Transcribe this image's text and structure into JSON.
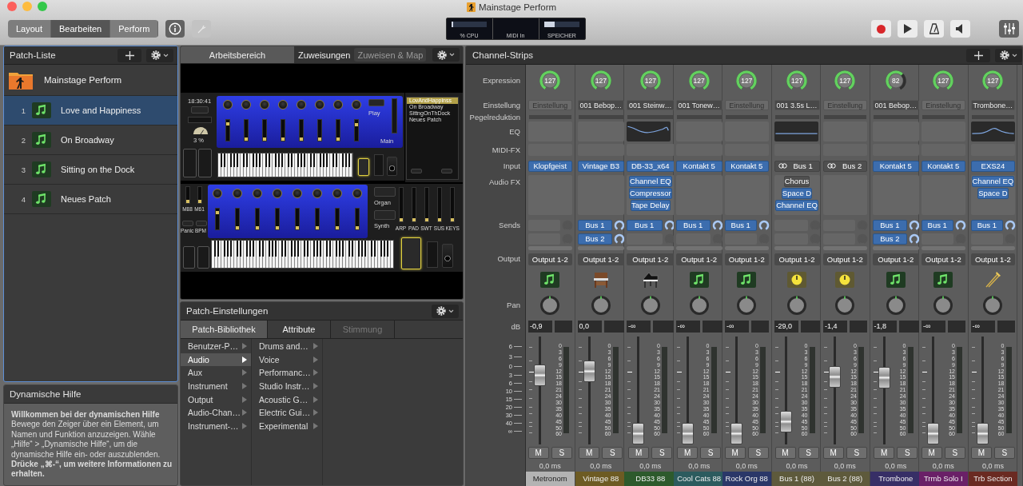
{
  "window": {
    "title": "Mainstage Perform"
  },
  "toolbar": {
    "modes": [
      {
        "label": "Layout",
        "selected": false
      },
      {
        "label": "Bearbeiten",
        "selected": true
      },
      {
        "label": "Perform",
        "selected": false
      }
    ],
    "meters": [
      {
        "label": "% CPU",
        "level": 0.05
      },
      {
        "label": "MIDI In"
      },
      {
        "label": "SPEICHER",
        "level": 0.3
      }
    ]
  },
  "patch_list": {
    "title": "Patch-Liste",
    "concert": "Mainstage Perform",
    "patches": [
      {
        "number": "1",
        "name": "Love and Happiness",
        "selected": true
      },
      {
        "number": "2",
        "name": "On Broadway",
        "selected": false
      },
      {
        "number": "3",
        "name": "Sitting on the Dock",
        "selected": false
      },
      {
        "number": "4",
        "name": "Neues Patch",
        "selected": false
      }
    ]
  },
  "help": {
    "title": "Dynamische Hilfe",
    "text": "**Willkommen bei der dynamischen Hilfe**\nBewege den Zeiger über ein Element, um Namen und Funktion anzuzeigen. Wähle „Hilfe“ > „Dynamische Hilfe“, um die dynamische Hilfe ein- oder auszublenden.\n**Drücke „⌘-“, um weitere Informationen zu erhalten.**"
  },
  "workspace": {
    "tabs": [
      {
        "label": "Arbeitsbereich",
        "selected": true
      },
      {
        "label": "Zuweisungen",
        "selected": false
      }
    ],
    "map_button": {
      "label": "Zuweisen & Map",
      "disabled": true
    },
    "layout": {
      "clock": "18:30:41",
      "cpu": "3 %",
      "play": "Play",
      "main": "Main",
      "panels": [
        {
          "sliders": [
            {
              "level": 0.85
            },
            {
              "level": 0
            },
            {
              "level": 0
            },
            {
              "level": 0
            },
            {
              "level": 0
            },
            {
              "level": 0
            },
            {
              "level": 0
            },
            {
              "level": 0.8
            }
          ]
        },
        {
          "sliders": [
            {
              "level": 0.85
            },
            {
              "level": 0
            },
            {
              "level": 0
            },
            {
              "level": 0
            },
            {
              "level": 0
            },
            {
              "level": 0
            },
            {
              "level": 0
            },
            {
              "level": 0
            }
          ]
        }
      ],
      "patch_display": [
        {
          "label": "LovAndHappinss",
          "selected": true
        },
        {
          "label": "On Broadway",
          "selected": false
        },
        {
          "label": "SittngOnThDock",
          "selected": false
        },
        {
          "label": "Neues Patch",
          "selected": false
        }
      ],
      "fader_labels": [
        {
          "label": "M88",
          "level": 0
        },
        {
          "label": "M61",
          "level": 0
        }
      ],
      "buttons": [
        "Panic",
        "BPM"
      ],
      "switches": [
        "Organ",
        "Synth"
      ],
      "slider_labels": [
        {
          "label": "ARP",
          "level": 0
        },
        {
          "label": "PAD",
          "level": 0
        },
        {
          "label": "SWT",
          "level": 0
        },
        {
          "label": "SUS",
          "level": 0
        },
        {
          "label": "KEYS",
          "level": 0
        }
      ]
    }
  },
  "patch_settings": {
    "title": "Patch-Einstellungen",
    "tabs": [
      {
        "label": "Patch-Bibliothek",
        "selected": true,
        "disabled": false
      },
      {
        "label": "Attribute",
        "selected": false,
        "disabled": false
      },
      {
        "label": "Stimmung",
        "selected": false,
        "disabled": true
      }
    ],
    "categories": [
      {
        "label": "Benutzer-P…",
        "selected": false
      },
      {
        "label": "Audio",
        "selected": true
      },
      {
        "label": "Aux",
        "selected": false
      },
      {
        "label": "Instrument",
        "selected": false
      },
      {
        "label": "Output",
        "selected": false
      },
      {
        "label": "Audio-Chan…",
        "selected": false
      },
      {
        "label": "Instrument-…",
        "selected": false
      }
    ],
    "subcategories": [
      {
        "label": "Drums and…",
        "selected": false
      },
      {
        "label": "Voice",
        "selected": false
      },
      {
        "label": "Performanc…",
        "selected": false
      },
      {
        "label": "Studio Instr…",
        "selected": false
      },
      {
        "label": "Acoustic G…",
        "selected": false
      },
      {
        "label": "Electric Gui…",
        "selected": false
      },
      {
        "label": "Experimental",
        "selected": false
      }
    ]
  },
  "channel_strips": {
    "title": "Channel-Strips",
    "row_labels": [
      "Expression",
      "Einstellung",
      "Pegelreduktion",
      "EQ",
      "MIDI-FX",
      "Input",
      "Audio FX",
      "Sends",
      "Output",
      "Pan",
      "dB"
    ],
    "fader_scale": [
      "6",
      "3",
      "0",
      "3",
      "6",
      "10",
      "15",
      "20",
      "30",
      "40",
      "∞"
    ],
    "strips": [
      {
        "kind": "note",
        "expression": "127",
        "setting": {
          "placeholder": "Einstellung"
        },
        "input": {
          "label": "Klopfgeist",
          "kind": "instrument"
        },
        "output": "Output 1-2",
        "volume": "-0,9",
        "fader": {
          "level": 0.67
        },
        "meter_scale": [
          "0",
          "3",
          "6",
          "9",
          "12",
          "15",
          "18",
          "21",
          "24",
          "30",
          "35",
          "40",
          "45",
          "50",
          "60"
        ],
        "mute": "M",
        "solo": "S",
        "delay": "0,0 ms",
        "name": "Metronom",
        "color": "#b3b3b3"
      },
      {
        "kind": "organ",
        "expression": "127",
        "setting": {
          "value": "001 Bebop…"
        },
        "input": {
          "label": "Vintage B3",
          "kind": "instrument"
        },
        "sends": [
          "Bus 1",
          "Bus 2"
        ],
        "output": "Output 1-2",
        "volume": "0,0",
        "fader": {
          "level": 0.72
        },
        "meter_scale": [
          "0",
          "3",
          "6",
          "9",
          "12",
          "15",
          "18",
          "21",
          "24",
          "30",
          "35",
          "40",
          "45",
          "50",
          "60"
        ],
        "mute": "M",
        "solo": "S",
        "delay": "0,0 ms",
        "name": "Vintage 88",
        "color": "#6d5b23"
      },
      {
        "kind": "piano",
        "expression": "127",
        "setting": {
          "value": "001 Steinw…"
        },
        "eq": {
          "kind": "shelf"
        },
        "input": {
          "label": "DB-33_x64",
          "kind": "instrument"
        },
        "audio_fx": [
          {
            "label": "Channel EQ",
            "on": true
          },
          {
            "label": "Compressor",
            "on": true
          },
          {
            "label": "Tape Delay",
            "on": true
          }
        ],
        "sends": [
          "Bus 1"
        ],
        "output": "Output 1-2",
        "volume": "-∞",
        "fader": {
          "level": 0
        },
        "meter_scale": [
          "0",
          "3",
          "6",
          "9",
          "12",
          "15",
          "18",
          "21",
          "24",
          "30",
          "35",
          "40",
          "45",
          "50",
          "60"
        ],
        "mute": "M",
        "solo": "S",
        "delay": "0,0 ms",
        "name": "DB33 88",
        "color": "#2d5a2c"
      },
      {
        "kind": "note",
        "expression": "127",
        "setting": {
          "value": "001 Tonew…"
        },
        "input": {
          "label": "Kontakt 5",
          "kind": "instrument"
        },
        "sends": [
          "Bus 1"
        ],
        "output": "Output 1-2",
        "volume": "-∞",
        "fader": {
          "level": 0
        },
        "meter_scale": [
          "0",
          "3",
          "6",
          "9",
          "12",
          "15",
          "18",
          "21",
          "24",
          "30",
          "35",
          "40",
          "45",
          "50",
          "60"
        ],
        "mute": "M",
        "solo": "S",
        "delay": "0,0 ms",
        "name": "Cool Cats 88",
        "color": "#2c5b5e"
      },
      {
        "kind": "note",
        "expression": "127",
        "setting": {
          "placeholder": "Einstellung"
        },
        "input": {
          "label": "Kontakt 5",
          "kind": "instrument"
        },
        "sends": [
          "Bus 1"
        ],
        "output": "Output 1-2",
        "volume": "-∞",
        "fader": {
          "level": 0
        },
        "meter_scale": [
          "0",
          "3",
          "6",
          "9",
          "12",
          "15",
          "18",
          "21",
          "24",
          "30",
          "35",
          "40",
          "45",
          "50",
          "60"
        ],
        "mute": "M",
        "solo": "S",
        "delay": "0,0 ms",
        "name": "Rock Org 88",
        "color": "#2a3768"
      },
      {
        "kind": "bus",
        "expression": "127",
        "setting": {
          "value": "001 3.5s L…"
        },
        "eq": {
          "kind": "flat"
        },
        "input": {
          "label": "Bus 1",
          "kind": "bus"
        },
        "audio_fx": [
          {
            "label": "Chorus",
            "on": false
          },
          {
            "label": "Space D",
            "on": true
          },
          {
            "label": "Channel EQ",
            "on": true
          }
        ],
        "output": "Output 1-2",
        "volume": "-29,0",
        "fader": {
          "level": 0.13
        },
        "meter_scale": [
          "0",
          "3",
          "6",
          "9",
          "12",
          "15",
          "18",
          "21",
          "24",
          "30",
          "35",
          "40",
          "45",
          "50",
          "60"
        ],
        "mute": "M",
        "solo": "S",
        "delay": "0,0 ms",
        "name": "Bus 1 (88)",
        "color": "#5e5a3c"
      },
      {
        "kind": "bus",
        "expression": "127",
        "setting": {
          "placeholder": "Einstellung"
        },
        "input": {
          "label": "Bus 2",
          "kind": "bus"
        },
        "output": "Output 1-2",
        "volume": "-1,4",
        "fader": {
          "level": 0.65
        },
        "meter_scale": [
          "0",
          "3",
          "6",
          "9",
          "12",
          "15",
          "18",
          "21",
          "24",
          "30",
          "35",
          "40",
          "45",
          "50",
          "60"
        ],
        "mute": "M",
        "solo": "S",
        "delay": "0,0 ms",
        "name": "Bus 2 (88)",
        "color": "#5e5a3c"
      },
      {
        "kind": "note",
        "expression": "82",
        "setting": {
          "value": "001 Bebop…"
        },
        "input": {
          "label": "Kontakt 5",
          "kind": "instrument"
        },
        "sends": [
          "Bus 1",
          "Bus 2"
        ],
        "output": "Output 1-2",
        "volume": "-1,8",
        "fader": {
          "level": 0.64
        },
        "meter_scale": [
          "0",
          "3",
          "6",
          "9",
          "12",
          "15",
          "18",
          "21",
          "24",
          "30",
          "35",
          "40",
          "45",
          "50",
          "60"
        ],
        "mute": "M",
        "solo": "S",
        "delay": "0,0 ms",
        "name": "Trombone",
        "color": "#372f66"
      },
      {
        "kind": "note",
        "expression": "127",
        "setting": {
          "placeholder": "Einstellung"
        },
        "input": {
          "label": "Kontakt 5",
          "kind": "instrument"
        },
        "sends": [
          "Bus 1"
        ],
        "output": "Output 1-2",
        "volume": "-∞",
        "fader": {
          "level": 0
        },
        "meter_scale": [
          "0",
          "3",
          "6",
          "9",
          "12",
          "15",
          "18",
          "21",
          "24",
          "30",
          "35",
          "40",
          "45",
          "50",
          "60"
        ],
        "mute": "M",
        "solo": "S",
        "delay": "0,0 ms",
        "name": "Trmb Solo I",
        "color": "#6a2067"
      },
      {
        "kind": "trombone",
        "expression": "127",
        "setting": {
          "value": "Trombone…"
        },
        "eq": {
          "kind": "peak"
        },
        "input": {
          "label": "EXS24",
          "kind": "instrument"
        },
        "audio_fx": [
          {
            "label": "Channel EQ",
            "on": true
          },
          {
            "label": "Space D",
            "on": true
          }
        ],
        "sends": [
          "Bus 1"
        ],
        "output": "Output 1-2",
        "volume": "-∞",
        "fader": {
          "level": 0
        },
        "meter_scale": [
          "0",
          "3",
          "6",
          "9",
          "12",
          "15",
          "18",
          "21",
          "24",
          "30",
          "35",
          "40",
          "45",
          "50",
          "60"
        ],
        "mute": "M",
        "solo": "S",
        "delay": "0,0 ms",
        "name": "Trb Section",
        "color": "#6a2a22"
      }
    ]
  }
}
